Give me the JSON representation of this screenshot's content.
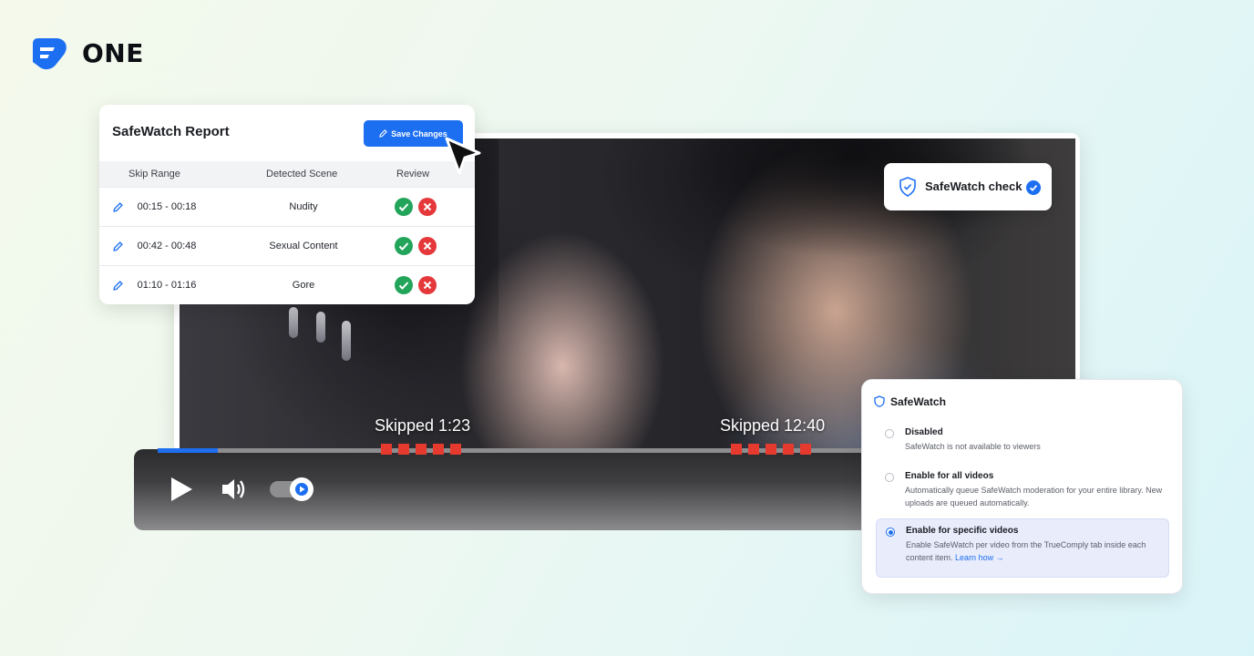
{
  "brand": {
    "name": "ONE",
    "logo_icon": "one-logo-icon",
    "accent": "#1d6ff2"
  },
  "report": {
    "title": "SafeWatch Report",
    "save_label": "Save Changes",
    "columns": [
      "Skip Range",
      "Detected Scene",
      "Review"
    ],
    "rows": [
      {
        "range": "00:15 - 00:18",
        "scene": "Nudity"
      },
      {
        "range": "00:42 - 00:48",
        "scene": "Sexual Content"
      },
      {
        "range": "01:10 - 01:16",
        "scene": "Gore"
      }
    ],
    "approve_color": "#22a55a",
    "reject_color": "#e5383b"
  },
  "badge": {
    "label": "SafeWatch check"
  },
  "player": {
    "skip_labels": [
      "Skipped 1:23",
      "Skipped 12:40"
    ],
    "progress_percent": 8.5,
    "skip_marker_color": "#e63a2e"
  },
  "settings": {
    "title": "SafeWatch",
    "options": [
      {
        "title": "Disabled",
        "description": "SafeWatch is not available to viewers",
        "selected": false
      },
      {
        "title": "Enable for all videos",
        "description": "Automatically queue SafeWatch moderation for your entire library. New uploads are queued automatically.",
        "selected": false
      },
      {
        "title": "Enable for specific videos",
        "description": "Enable SafeWatch per video from the TrueComply tab inside each content item.",
        "link": "Learn how →",
        "selected": true
      }
    ]
  }
}
